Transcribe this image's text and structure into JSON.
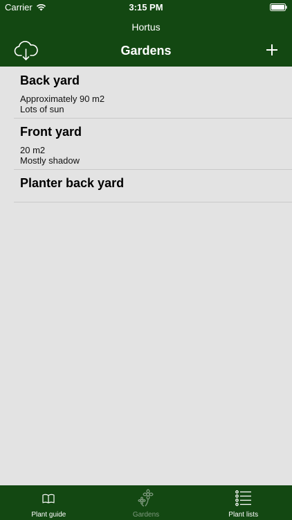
{
  "status": {
    "carrier": "Carrier",
    "time": "3:15 PM"
  },
  "header": {
    "app_title": "Hortus",
    "nav_title": "Gardens",
    "cloud_icon": "cloud-download-icon",
    "add_icon": "plus-icon"
  },
  "gardens": [
    {
      "title": "Back yard",
      "lines": [
        "Approximately 90 m2",
        "Lots of sun"
      ]
    },
    {
      "title": "Front yard",
      "lines": [
        "20 m2",
        "Mostly shadow"
      ]
    },
    {
      "title": "Planter back yard",
      "lines": []
    }
  ],
  "tabbar": {
    "tabs": [
      {
        "label": "Plant guide",
        "icon": "book-icon",
        "selected": false
      },
      {
        "label": "Gardens",
        "icon": "flowers-icon",
        "selected": true
      },
      {
        "label": "Plant lists",
        "icon": "checklist-icon",
        "selected": false
      }
    ]
  },
  "colors": {
    "brand": "#134812",
    "background": "#e3e3e3",
    "separator": "#c9c9c9",
    "tab_selected_text": "#7f9a7f"
  }
}
